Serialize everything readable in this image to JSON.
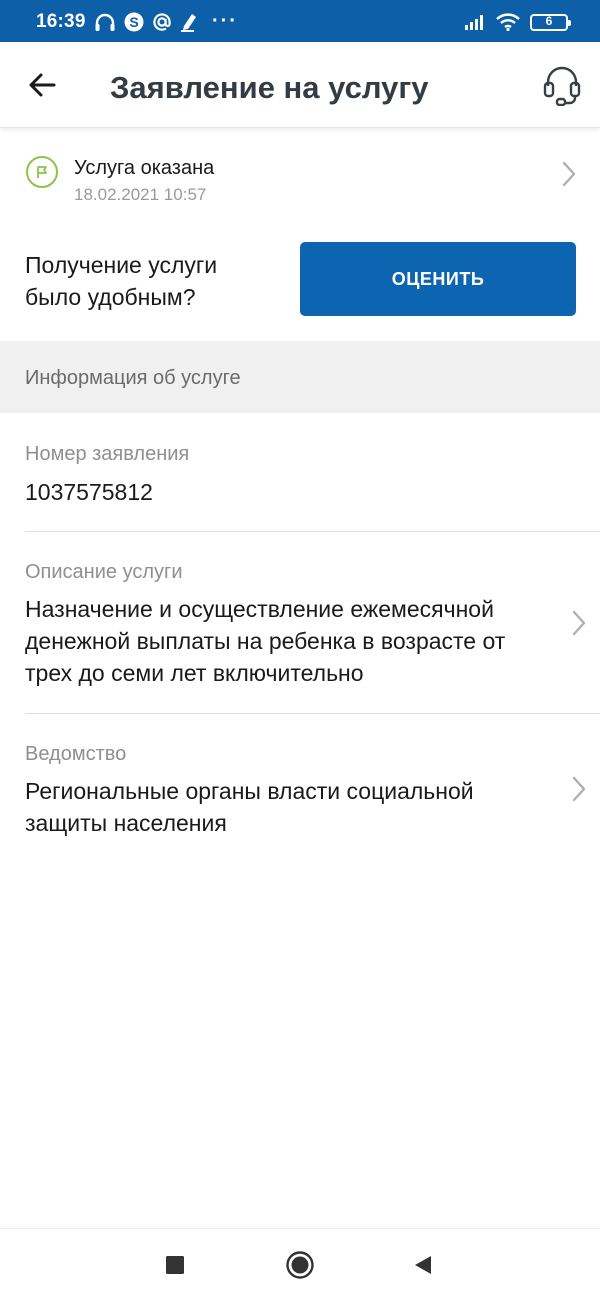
{
  "status_bar": {
    "time": "16:39",
    "dots": "···",
    "battery": "6",
    "icons": [
      "headphones-icon",
      "skype-icon",
      "at-sign-icon",
      "pen-icon",
      "signal-icon",
      "wifi-icon",
      "battery-icon"
    ]
  },
  "app_bar": {
    "title": "Заявление на услугу",
    "back_icon": "arrow-left-icon",
    "support_icon": "headset-icon"
  },
  "service_status": {
    "text": "Услуга оказана",
    "date": "18.02.2021 10:57",
    "icon": "flag-icon",
    "icon_color": "#8bc34a"
  },
  "rating": {
    "question": "Получение услуги было удобным?",
    "button_label": "ОЦЕНИТЬ",
    "button_color": "#0d65b1"
  },
  "section": {
    "title": "Информация об услуге"
  },
  "info": {
    "number_label": "Номер заявления",
    "number_value": "1037575812",
    "description_label": "Описание услуги",
    "description_value": "Назначение и осуществление ежемесячной денежной выплаты на ребенка в возрасте от трех до семи лет включительно",
    "department_label": "Ведомство",
    "department_value": "Региональные органы власти социальной защиты населения"
  },
  "nav": {
    "icons": [
      "square-recents-icon",
      "circle-home-icon",
      "triangle-back-icon"
    ]
  },
  "colors": {
    "status_bar": "#0d5fa8",
    "accent": "#0d65b1",
    "success": "#8bc34a"
  }
}
